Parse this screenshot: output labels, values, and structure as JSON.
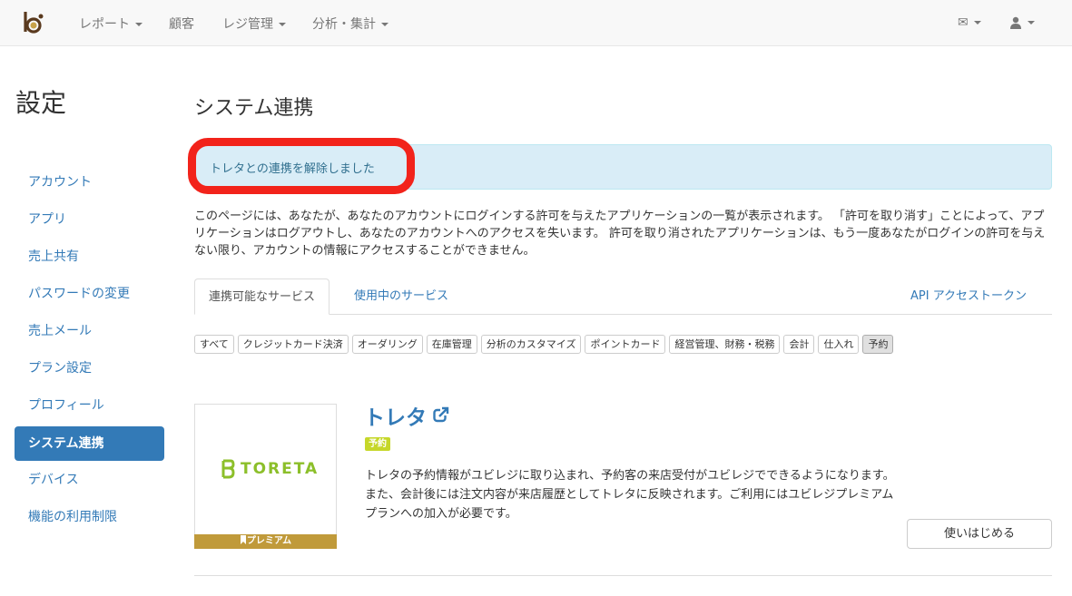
{
  "navbar": {
    "items": [
      {
        "label": "レポート",
        "dropdown": true
      },
      {
        "label": "顧客",
        "dropdown": false
      },
      {
        "label": "レジ管理",
        "dropdown": true
      },
      {
        "label": "分析・集計",
        "dropdown": true
      }
    ],
    "mail_icon": "✉",
    "user_icon": "👤"
  },
  "sidebar": {
    "title": "設定",
    "items": [
      {
        "label": "アカウント"
      },
      {
        "label": "アプリ"
      },
      {
        "label": "売上共有"
      },
      {
        "label": "パスワードの変更"
      },
      {
        "label": "売上メール"
      },
      {
        "label": "プラン設定"
      },
      {
        "label": "プロフィール"
      },
      {
        "label": "システム連携",
        "active": true
      },
      {
        "label": "デバイス"
      },
      {
        "label": "機能の利用制限"
      }
    ]
  },
  "main": {
    "title": "システム連携",
    "alert": "トレタとの連携を解除しました",
    "description": "このページには、あなたが、あなたのアカウントにログインする許可を与えたアプリケーションの一覧が表示されます。 「許可を取り消す」ことによって、アプリケーションはログアウトし、あなたのアカウントへのアクセスを失います。 許可を取り消されたアプリケーションは、もう一度あなたがログインの許可を与えない限り、アカウントの情報にアクセスすることができません。",
    "tabs": [
      {
        "label": "連携可能なサービス",
        "active": true
      },
      {
        "label": "使用中のサービス"
      },
      {
        "label": "API アクセストークン"
      }
    ],
    "filters": [
      "すべて",
      "クレジットカード決済",
      "オーダリング",
      "在庫管理",
      "分析のカスタマイズ",
      "ポイントカード",
      "経営管理、財務・税務",
      "会計",
      "仕入れ",
      "予約"
    ],
    "selected_filter": "予約",
    "card": {
      "logo_text": "TORETA",
      "premium_label": "プレミアム",
      "title": "トレタ",
      "badge": "予約",
      "description": "トレタの予約情報がユビレジに取り込まれ、予約客の来店受付がユビレジでできるようになります。また、会計後には注文内容が来店履歴としてトレタに反映されます。ご利用にはユビレジプレミアムプランへの加入が必要です。",
      "start_button": "使いはじめる"
    }
  },
  "colors": {
    "link": "#337ab7",
    "alert_bg": "#d9edf7",
    "highlight": "#f2231b",
    "toreta_green": "#8cbf2a",
    "premium_gold": "#c09a3a",
    "badge": "#c6d72a"
  }
}
